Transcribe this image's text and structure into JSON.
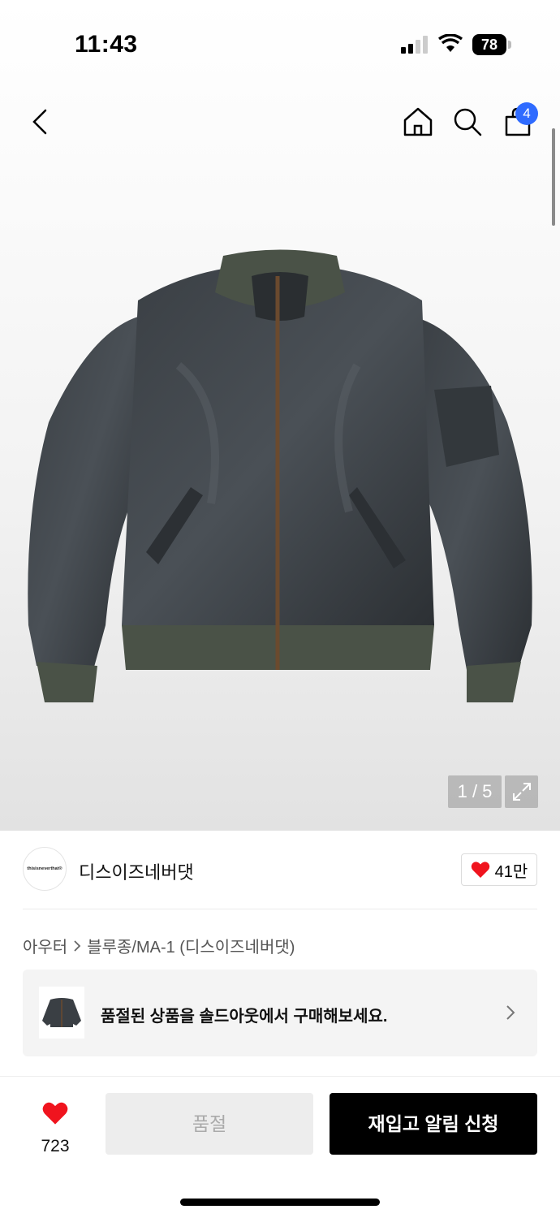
{
  "status_bar": {
    "time": "11:43",
    "battery_level": "78",
    "icons": [
      "signal-icon",
      "wifi-icon",
      "battery-icon"
    ]
  },
  "nav": {
    "icons": [
      "back-icon",
      "home-icon",
      "search-icon",
      "cart-icon"
    ],
    "cart_count": "4"
  },
  "gallery": {
    "counter": "1 / 5",
    "icon": "expand-icon"
  },
  "brand": {
    "logo_text": "thisisneverthat®",
    "name": "디스이즈네버댓",
    "likes": "41만"
  },
  "breadcrumb": {
    "category": "아우터",
    "subcategory": "블루종/MA-1 (디스이즈네버댓)"
  },
  "soldout_banner": {
    "text": "품절된 상품을 솔드아웃에서 구매해보세요."
  },
  "bottom_bar": {
    "wish_count": "723",
    "soldout_label": "품절",
    "restock_label": "재입고 알림 신청"
  },
  "colors": {
    "accent_blue": "#2f6bff",
    "heart_red": "#f0141e",
    "black": "#000000"
  }
}
